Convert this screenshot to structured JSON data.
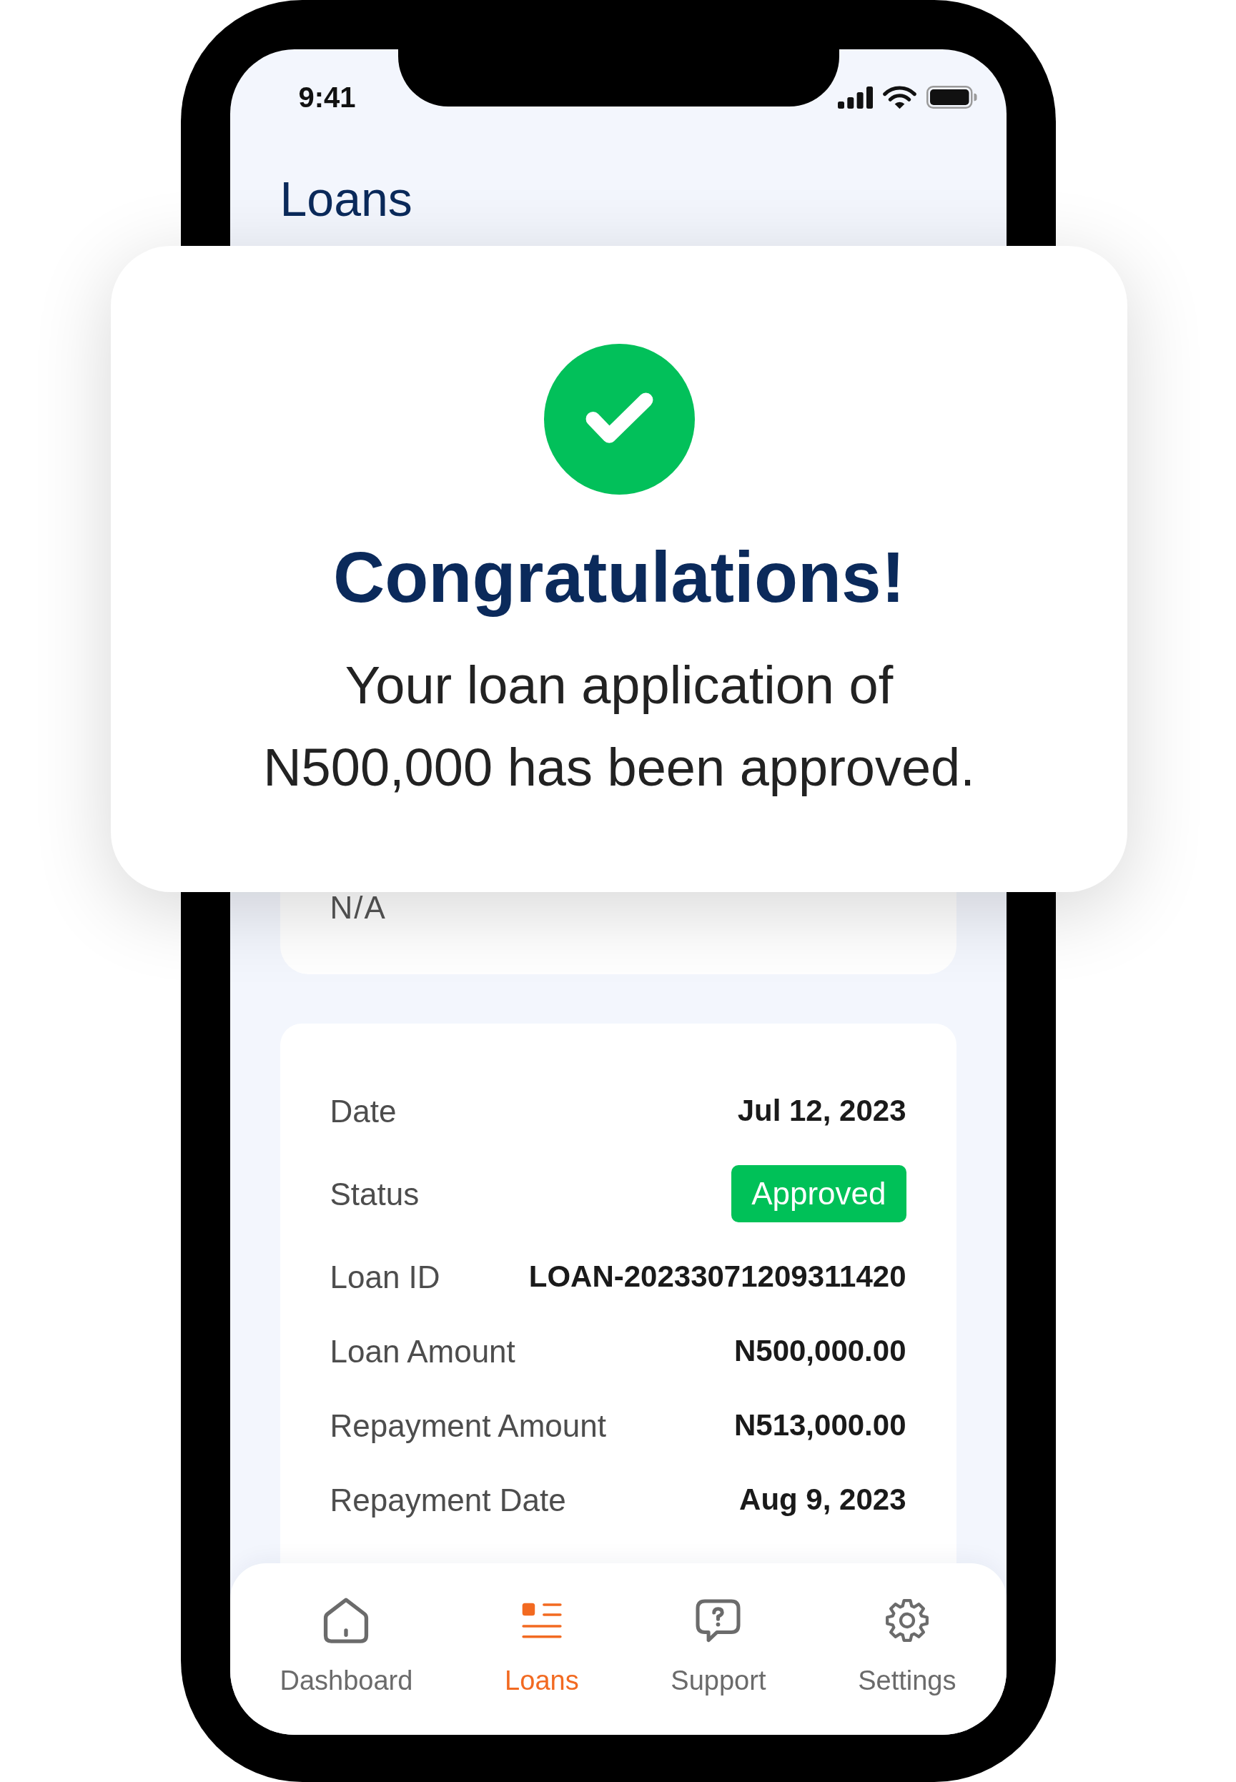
{
  "status_bar": {
    "time": "9:41"
  },
  "header": {
    "title": "Loans"
  },
  "dialog": {
    "title": "Congratulations!",
    "message": "Your loan application of N500,000 has been approved."
  },
  "info_card": {
    "value": "N/A"
  },
  "details": {
    "rows": [
      {
        "kind": "text",
        "label": "Date",
        "value": "Jul 12, 2023"
      },
      {
        "kind": "badge",
        "label": "Status",
        "value": "Approved"
      },
      {
        "kind": "text",
        "label": "Loan ID",
        "value": "LOAN-20233071209311420"
      },
      {
        "kind": "text",
        "label": "Loan Amount",
        "value": "N500,000.00"
      },
      {
        "kind": "text",
        "label": "Repayment Amount",
        "value": "N513,000.00"
      },
      {
        "kind": "text",
        "label": "Repayment Date",
        "value": "Aug 9, 2023"
      }
    ]
  },
  "bottom_nav": {
    "items": [
      {
        "label": "Dashboard",
        "selected": false
      },
      {
        "label": "Loans",
        "selected": true
      },
      {
        "label": "Support",
        "selected": false
      },
      {
        "label": "Settings",
        "selected": false
      }
    ]
  }
}
